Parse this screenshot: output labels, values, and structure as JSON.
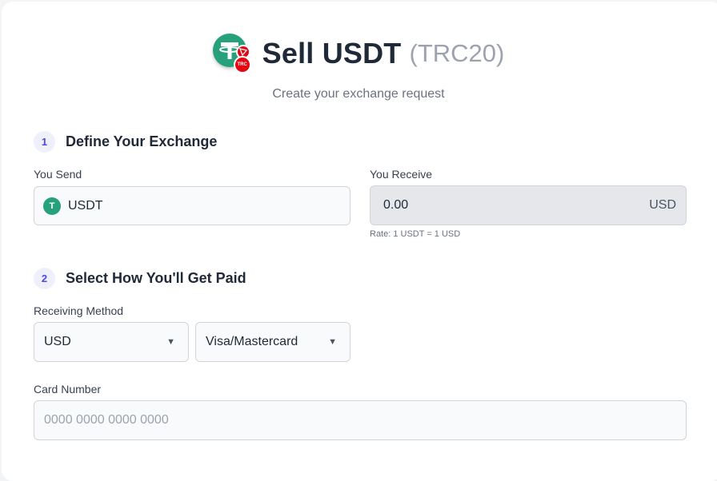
{
  "header": {
    "title": "Sell USDT",
    "network": "(TRC20)",
    "subtitle": "Create your exchange request",
    "badge_text": "TRC"
  },
  "step1": {
    "number": "1",
    "title": "Define Your Exchange",
    "send_label": "You Send",
    "send_coin_icon": "T",
    "send_currency": "USDT",
    "receive_label": "You Receive",
    "receive_amount": "0.00",
    "receive_currency": "USD",
    "rate": "Rate: 1 USDT = 1 USD"
  },
  "step2": {
    "number": "2",
    "title": "Select How You'll Get Paid",
    "method_label": "Receiving Method",
    "currency_select": "USD",
    "method_select": "Visa/Mastercard",
    "card_label": "Card Number",
    "card_placeholder": "0000 0000 0000 0000"
  },
  "colors": {
    "tether_green": "#26a17b",
    "tron_red": "#e30613",
    "step_accent": "#4f46e5"
  },
  "icons": [
    "tether-logo-icon",
    "tron-badge-icon",
    "usdt-coin-icon",
    "caret-down-icon"
  ]
}
